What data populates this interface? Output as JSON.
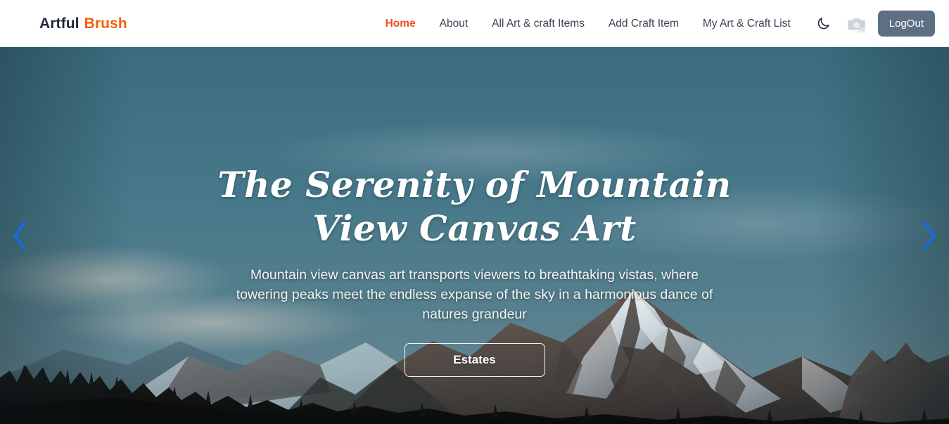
{
  "navbar": {
    "brand": {
      "first": "Artful",
      "second": "Brush"
    },
    "links": [
      {
        "label": "Home",
        "active": true
      },
      {
        "label": "About",
        "active": false
      },
      {
        "label": "All Art & craft Items",
        "active": false
      },
      {
        "label": "Add Craft Item",
        "active": false
      },
      {
        "label": "My Art & Craft List",
        "active": false
      }
    ],
    "theme_toggle_icon": "moon-icon",
    "avatar_icon": "broken-image-icon",
    "logout_label": "LogOut",
    "logout_bg": "#5e6e83",
    "active_link_color": "#f6491c",
    "brand_accent_color": "#f2600c"
  },
  "hero": {
    "title": "The Serenity of Mountain View Canvas Art",
    "subtitle": "Mountain view canvas art transports viewers to breathtaking vistas, where towering peaks meet the endless expanse of the sky in a harmonious dance of natures grandeur",
    "cta_label": "Estates",
    "prev_icon": "chevron-left-icon",
    "next_icon": "chevron-right-icon",
    "arrow_color": "#0d6efd",
    "image_alt": "snow-capped mountain range at dusk with dark pine forest silhouette under a teal sky"
  }
}
